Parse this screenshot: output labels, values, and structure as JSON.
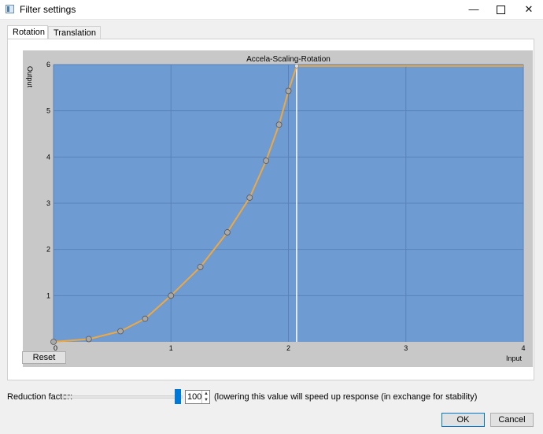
{
  "window": {
    "title": "Filter settings",
    "controls": {
      "minimize": "—",
      "close": "✕"
    }
  },
  "tabs": [
    {
      "label": "Rotation",
      "active": true
    },
    {
      "label": "Translation",
      "active": false
    }
  ],
  "chart_data": {
    "type": "line",
    "title": "Accela-Scaling-Rotation",
    "xlabel": "Input",
    "ylabel": "Output",
    "xlim": [
      0,
      4
    ],
    "ylim": [
      0,
      6
    ],
    "x_ticks": [
      "0",
      "1",
      "2",
      "3",
      "4"
    ],
    "y_ticks": [
      "1",
      "2",
      "3",
      "4",
      "5",
      "6"
    ],
    "grid": true,
    "plot_color": "#6f9bd3",
    "curve_color": "#f0a83c",
    "points": [
      {
        "x": 0.0,
        "y": 0.0
      },
      {
        "x": 0.3,
        "y": 0.06
      },
      {
        "x": 0.57,
        "y": 0.23
      },
      {
        "x": 0.78,
        "y": 0.5
      },
      {
        "x": 1.0,
        "y": 1.0
      },
      {
        "x": 1.25,
        "y": 1.62
      },
      {
        "x": 1.48,
        "y": 2.37
      },
      {
        "x": 1.67,
        "y": 3.12
      },
      {
        "x": 1.81,
        "y": 3.92
      },
      {
        "x": 1.92,
        "y": 4.7
      },
      {
        "x": 2.0,
        "y": 5.43
      }
    ],
    "saturation_point": {
      "x": 2.07,
      "y": 5.97
    },
    "cursor_x": 2.07,
    "flat_segment": {
      "x_end": 4.0,
      "y": 5.97
    }
  },
  "reset_label": "Reset",
  "reduction": {
    "label": "Reduction factor:",
    "value": "100",
    "hint": "(lowering this value will speed up response (in exchange for stability)"
  },
  "buttons": {
    "ok": "OK",
    "cancel": "Cancel"
  }
}
